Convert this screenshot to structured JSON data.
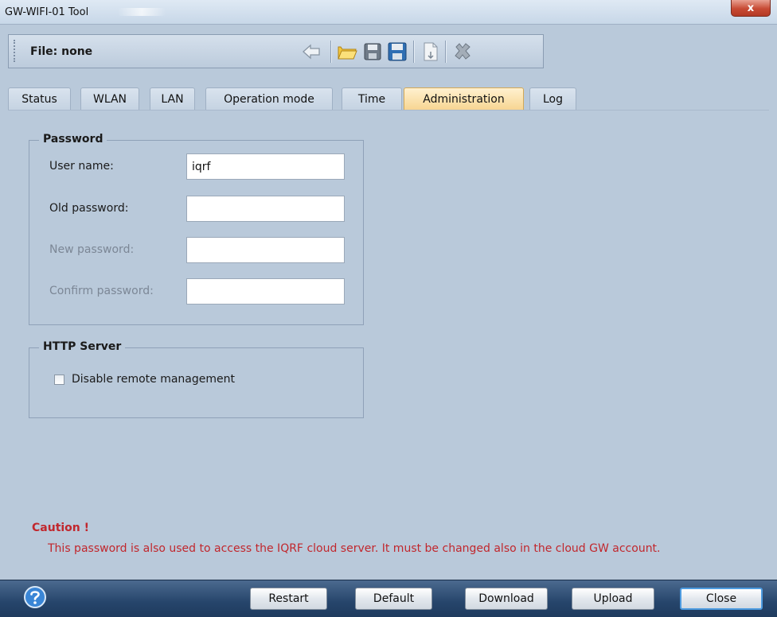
{
  "window": {
    "title": "GW-WIFI-01 Tool",
    "close_label": "x"
  },
  "toolbar": {
    "file_label": "File: none",
    "icons": [
      "back-arrow-icon",
      "open-folder-icon",
      "save-icon",
      "save-as-icon",
      "export-icon",
      "delete-icon"
    ]
  },
  "tabs": [
    {
      "label": "Status",
      "active": false
    },
    {
      "label": "WLAN",
      "active": false
    },
    {
      "label": "LAN",
      "active": false
    },
    {
      "label": "Operation mode",
      "active": false
    },
    {
      "label": "Time",
      "active": false
    },
    {
      "label": "Administration",
      "active": true
    },
    {
      "label": "Log",
      "active": false
    }
  ],
  "password_group": {
    "legend": "Password",
    "user_name_label": "User name:",
    "user_name_value": "iqrf",
    "old_password_label": "Old password:",
    "old_password_value": "",
    "new_password_label": "New password:",
    "new_password_value": "",
    "confirm_password_label": "Confirm password:",
    "confirm_password_value": ""
  },
  "http_group": {
    "legend": "HTTP Server",
    "disable_remote_label": "Disable remote management",
    "disable_remote_checked": false
  },
  "caution": {
    "title": "Caution !",
    "text": "This password is also used to access the IQRF cloud server. It must be changed also in the cloud GW account."
  },
  "buttons": {
    "restart": "Restart",
    "default": "Default",
    "download": "Download",
    "upload": "Upload",
    "close": "Close"
  },
  "colors": {
    "background": "#b9c9da",
    "active_tab": "#f7d592",
    "caution": "#c1272d",
    "bottom_bar": "#26456b"
  }
}
